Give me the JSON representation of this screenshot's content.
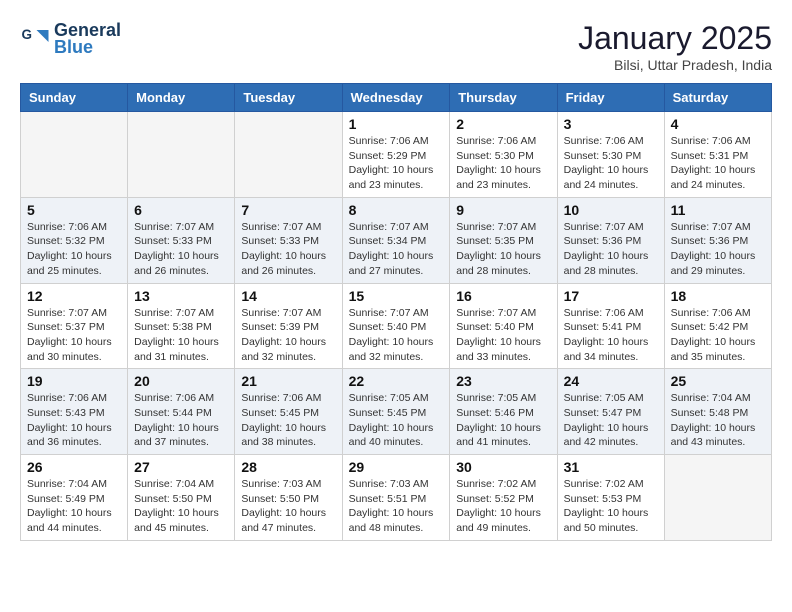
{
  "header": {
    "logo_line1": "General",
    "logo_line2": "Blue",
    "month": "January 2025",
    "location": "Bilsi, Uttar Pradesh, India"
  },
  "weekdays": [
    "Sunday",
    "Monday",
    "Tuesday",
    "Wednesday",
    "Thursday",
    "Friday",
    "Saturday"
  ],
  "weeks": [
    [
      {
        "day": "",
        "info": ""
      },
      {
        "day": "",
        "info": ""
      },
      {
        "day": "",
        "info": ""
      },
      {
        "day": "1",
        "info": "Sunrise: 7:06 AM\nSunset: 5:29 PM\nDaylight: 10 hours\nand 23 minutes."
      },
      {
        "day": "2",
        "info": "Sunrise: 7:06 AM\nSunset: 5:30 PM\nDaylight: 10 hours\nand 23 minutes."
      },
      {
        "day": "3",
        "info": "Sunrise: 7:06 AM\nSunset: 5:30 PM\nDaylight: 10 hours\nand 24 minutes."
      },
      {
        "day": "4",
        "info": "Sunrise: 7:06 AM\nSunset: 5:31 PM\nDaylight: 10 hours\nand 24 minutes."
      }
    ],
    [
      {
        "day": "5",
        "info": "Sunrise: 7:06 AM\nSunset: 5:32 PM\nDaylight: 10 hours\nand 25 minutes."
      },
      {
        "day": "6",
        "info": "Sunrise: 7:07 AM\nSunset: 5:33 PM\nDaylight: 10 hours\nand 26 minutes."
      },
      {
        "day": "7",
        "info": "Sunrise: 7:07 AM\nSunset: 5:33 PM\nDaylight: 10 hours\nand 26 minutes."
      },
      {
        "day": "8",
        "info": "Sunrise: 7:07 AM\nSunset: 5:34 PM\nDaylight: 10 hours\nand 27 minutes."
      },
      {
        "day": "9",
        "info": "Sunrise: 7:07 AM\nSunset: 5:35 PM\nDaylight: 10 hours\nand 28 minutes."
      },
      {
        "day": "10",
        "info": "Sunrise: 7:07 AM\nSunset: 5:36 PM\nDaylight: 10 hours\nand 28 minutes."
      },
      {
        "day": "11",
        "info": "Sunrise: 7:07 AM\nSunset: 5:36 PM\nDaylight: 10 hours\nand 29 minutes."
      }
    ],
    [
      {
        "day": "12",
        "info": "Sunrise: 7:07 AM\nSunset: 5:37 PM\nDaylight: 10 hours\nand 30 minutes."
      },
      {
        "day": "13",
        "info": "Sunrise: 7:07 AM\nSunset: 5:38 PM\nDaylight: 10 hours\nand 31 minutes."
      },
      {
        "day": "14",
        "info": "Sunrise: 7:07 AM\nSunset: 5:39 PM\nDaylight: 10 hours\nand 32 minutes."
      },
      {
        "day": "15",
        "info": "Sunrise: 7:07 AM\nSunset: 5:40 PM\nDaylight: 10 hours\nand 32 minutes."
      },
      {
        "day": "16",
        "info": "Sunrise: 7:07 AM\nSunset: 5:40 PM\nDaylight: 10 hours\nand 33 minutes."
      },
      {
        "day": "17",
        "info": "Sunrise: 7:06 AM\nSunset: 5:41 PM\nDaylight: 10 hours\nand 34 minutes."
      },
      {
        "day": "18",
        "info": "Sunrise: 7:06 AM\nSunset: 5:42 PM\nDaylight: 10 hours\nand 35 minutes."
      }
    ],
    [
      {
        "day": "19",
        "info": "Sunrise: 7:06 AM\nSunset: 5:43 PM\nDaylight: 10 hours\nand 36 minutes."
      },
      {
        "day": "20",
        "info": "Sunrise: 7:06 AM\nSunset: 5:44 PM\nDaylight: 10 hours\nand 37 minutes."
      },
      {
        "day": "21",
        "info": "Sunrise: 7:06 AM\nSunset: 5:45 PM\nDaylight: 10 hours\nand 38 minutes."
      },
      {
        "day": "22",
        "info": "Sunrise: 7:05 AM\nSunset: 5:45 PM\nDaylight: 10 hours\nand 40 minutes."
      },
      {
        "day": "23",
        "info": "Sunrise: 7:05 AM\nSunset: 5:46 PM\nDaylight: 10 hours\nand 41 minutes."
      },
      {
        "day": "24",
        "info": "Sunrise: 7:05 AM\nSunset: 5:47 PM\nDaylight: 10 hours\nand 42 minutes."
      },
      {
        "day": "25",
        "info": "Sunrise: 7:04 AM\nSunset: 5:48 PM\nDaylight: 10 hours\nand 43 minutes."
      }
    ],
    [
      {
        "day": "26",
        "info": "Sunrise: 7:04 AM\nSunset: 5:49 PM\nDaylight: 10 hours\nand 44 minutes."
      },
      {
        "day": "27",
        "info": "Sunrise: 7:04 AM\nSunset: 5:50 PM\nDaylight: 10 hours\nand 45 minutes."
      },
      {
        "day": "28",
        "info": "Sunrise: 7:03 AM\nSunset: 5:50 PM\nDaylight: 10 hours\nand 47 minutes."
      },
      {
        "day": "29",
        "info": "Sunrise: 7:03 AM\nSunset: 5:51 PM\nDaylight: 10 hours\nand 48 minutes."
      },
      {
        "day": "30",
        "info": "Sunrise: 7:02 AM\nSunset: 5:52 PM\nDaylight: 10 hours\nand 49 minutes."
      },
      {
        "day": "31",
        "info": "Sunrise: 7:02 AM\nSunset: 5:53 PM\nDaylight: 10 hours\nand 50 minutes."
      },
      {
        "day": "",
        "info": ""
      }
    ]
  ]
}
